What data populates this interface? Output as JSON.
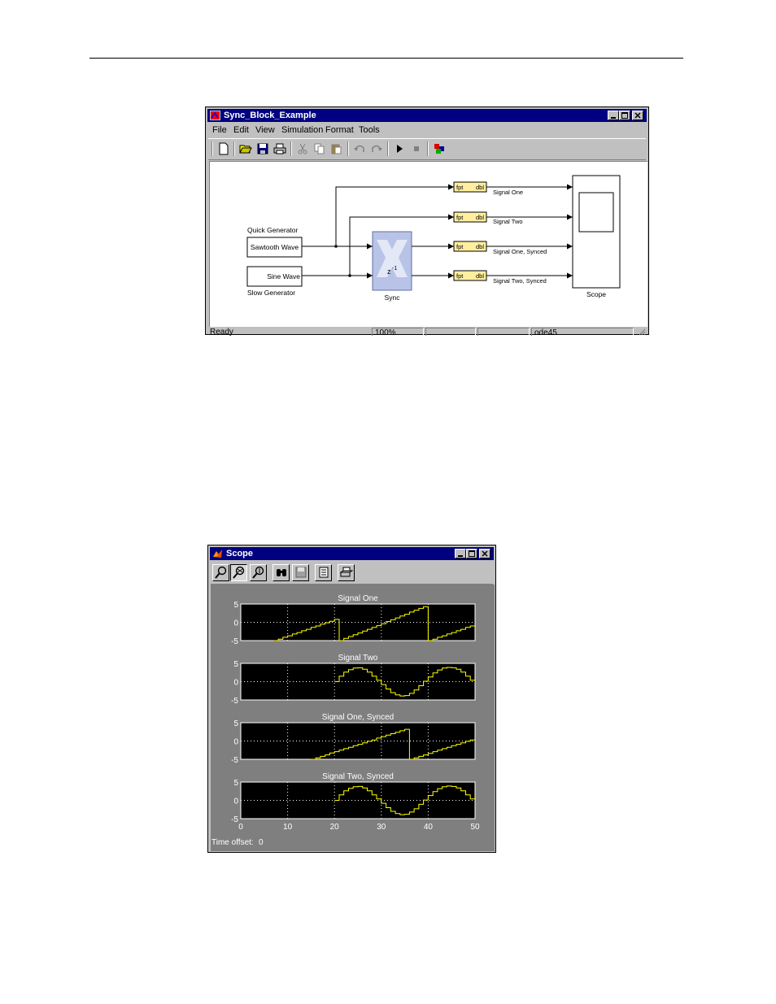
{
  "sim_window": {
    "title": "Sync_Block_Example",
    "menu": [
      "File",
      "Edit",
      "View",
      "Simulation",
      "Format",
      "Tools"
    ],
    "toolbar_icons": [
      "new-icon",
      "open-icon",
      "save-icon",
      "print-icon",
      "cut-icon",
      "copy-icon",
      "paste-icon",
      "undo-icon",
      "redo-icon",
      "start-icon",
      "stop-icon",
      "library-browser-icon"
    ],
    "blocks": {
      "quick_generator_label": "Quick Generator",
      "sawtooth": "Sawtooth Wave",
      "sine": "Sine Wave",
      "slow_generator_label": "Slow Generator",
      "sync_label": "Sync",
      "sync_symbol": "z",
      "sync_exp": "-1",
      "converter_left": "fpt",
      "converter_right": "dbl",
      "scope_label": "Scope"
    },
    "signals": [
      "Signal One",
      "Signal Two",
      "Signal One, Synced",
      "Signal Two, Synced"
    ],
    "status": {
      "ready": "Ready",
      "zoom": "100%",
      "blank1": "",
      "blank2": "",
      "solver": "ode45"
    }
  },
  "scope_window": {
    "title": "Scope",
    "toolbar_icons": [
      "zoom-icon",
      "zoom-x-icon",
      "zoom-y-icon",
      "autoscale-icon",
      "save-axes-icon",
      "parameters-icon",
      "print-icon"
    ],
    "time_offset_label": "Time offset:",
    "time_offset_value": "0"
  },
  "chart_data": [
    {
      "type": "line",
      "title": "Signal One",
      "xlim": [
        0,
        50
      ],
      "ylim": [
        -5,
        5
      ],
      "yticks": [
        "5",
        "0",
        "-5"
      ],
      "grid": true,
      "x": [
        0,
        7,
        8,
        9,
        10,
        11,
        12,
        13,
        14,
        15,
        16,
        17,
        18,
        19,
        20,
        21,
        22,
        23,
        24,
        25,
        26,
        27,
        28,
        29,
        30,
        31,
        32,
        33,
        34,
        35,
        36,
        37,
        38,
        39,
        40,
        41,
        42,
        43,
        44,
        45,
        46,
        47,
        48,
        49,
        50
      ],
      "values": [
        null,
        -5,
        -4.6,
        -4.1,
        -3.7,
        -3.2,
        -2.8,
        -2.3,
        -1.9,
        -1.4,
        -1,
        -0.5,
        -0.1,
        0.3,
        0.8,
        -5,
        -4.4,
        -3.9,
        -3.4,
        -2.9,
        -2.4,
        -1.9,
        -1.4,
        -0.9,
        -0.4,
        0.2,
        0.7,
        1.2,
        1.7,
        2.2,
        2.8,
        3.3,
        3.8,
        4.3,
        -5,
        -4.6,
        -4.1,
        -3.7,
        -3.2,
        -2.8,
        -2.3,
        -1.9,
        -1.4,
        -1,
        -0.5
      ]
    },
    {
      "type": "line",
      "title": "Signal Two",
      "xlim": [
        0,
        50
      ],
      "ylim": [
        -5,
        5
      ],
      "yticks": [
        "5",
        "0",
        "-5"
      ],
      "grid": true,
      "x": [
        0,
        20,
        21,
        22,
        23,
        24,
        25,
        26,
        27,
        28,
        29,
        30,
        31,
        32,
        33,
        34,
        35,
        36,
        37,
        38,
        39,
        40,
        41,
        42,
        43,
        44,
        45,
        46,
        47,
        48,
        49,
        50
      ],
      "values": [
        null,
        0,
        1.5,
        2.6,
        3.3,
        3.7,
        3.8,
        3.4,
        2.6,
        1.5,
        0.4,
        -0.8,
        -2,
        -3,
        -3.6,
        -3.9,
        -3.8,
        -3.2,
        -2.3,
        -1.1,
        0.1,
        1.3,
        2.4,
        3.2,
        3.7,
        3.9,
        3.8,
        3.4,
        2.6,
        1.5,
        0.4
      ]
    },
    {
      "type": "line",
      "title": "Signal One, Synced",
      "xlim": [
        0,
        50
      ],
      "ylim": [
        -5,
        5
      ],
      "yticks": [
        "5",
        "0",
        "-5"
      ],
      "grid": true,
      "x": [
        0,
        15,
        16,
        17,
        18,
        19,
        20,
        21,
        22,
        23,
        24,
        25,
        26,
        27,
        28,
        29,
        30,
        31,
        32,
        33,
        34,
        35,
        36,
        37,
        38,
        39,
        40,
        41,
        42,
        43,
        44,
        45,
        46,
        47,
        48,
        49,
        50
      ],
      "values": [
        null,
        -5,
        -4.6,
        -4.2,
        -3.8,
        -3.3,
        -2.9,
        -2.5,
        -2.1,
        -1.7,
        -1.3,
        -0.9,
        -0.5,
        -0.1,
        0.3,
        0.8,
        1.2,
        1.6,
        2,
        2.4,
        2.8,
        3.2,
        -5,
        -4.6,
        -4.2,
        -3.8,
        -3.4,
        -2.9,
        -2.5,
        -2.1,
        -1.7,
        -1.3,
        -0.9,
        -0.5,
        -0.1,
        0.3,
        0.7
      ]
    },
    {
      "type": "line",
      "title": "Signal Two, Synced",
      "xlim": [
        0,
        50
      ],
      "ylim": [
        -5,
        5
      ],
      "yticks": [
        "5",
        "0",
        "-5"
      ],
      "xticks": [
        "0",
        "10",
        "20",
        "30",
        "40",
        "50"
      ],
      "grid": true,
      "x": [
        0,
        20,
        21,
        22,
        23,
        24,
        25,
        26,
        27,
        28,
        29,
        30,
        31,
        32,
        33,
        34,
        35,
        36,
        37,
        38,
        39,
        40,
        41,
        42,
        43,
        44,
        45,
        46,
        47,
        48,
        49,
        50
      ],
      "values": [
        null,
        0,
        1.5,
        2.6,
        3.3,
        3.7,
        3.8,
        3.4,
        2.6,
        1.5,
        0.4,
        -0.8,
        -2,
        -3,
        -3.6,
        -3.9,
        -3.8,
        -3.2,
        -2.3,
        -1.1,
        0.1,
        1.3,
        2.4,
        3.2,
        3.7,
        3.9,
        3.8,
        3.4,
        2.6,
        1.5,
        0.4
      ]
    }
  ]
}
